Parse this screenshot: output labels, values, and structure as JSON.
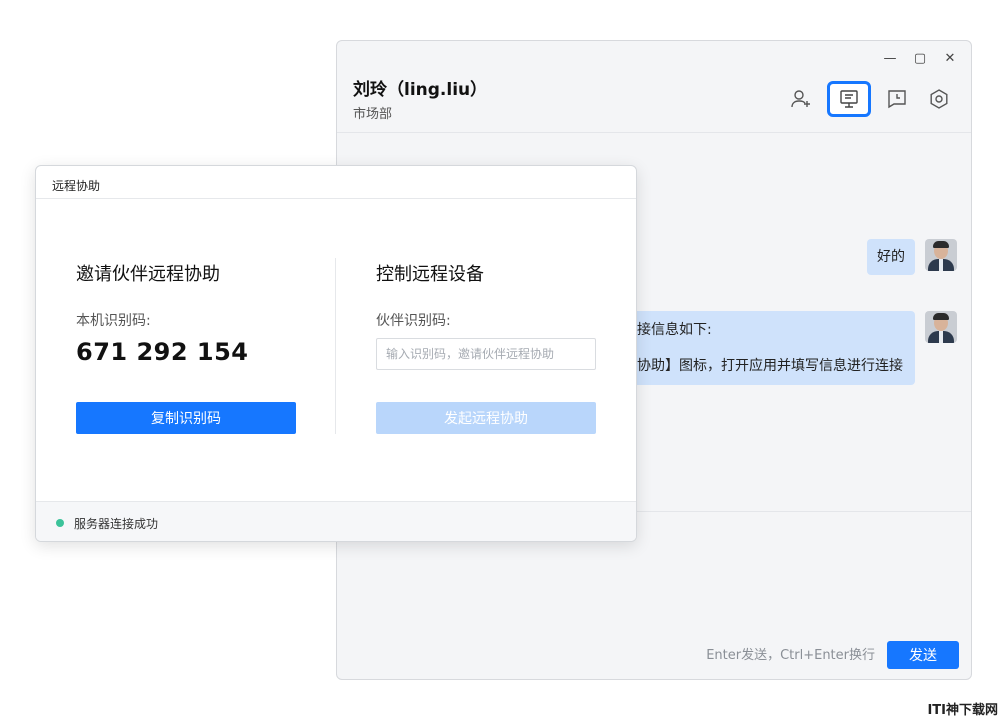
{
  "chat": {
    "contact_name": "刘玲（ling.liu）",
    "department": "市场部",
    "window_controls": {
      "minimize": "—",
      "maximize": "▢",
      "close": "✕"
    },
    "messages": [
      {
        "text": "好的"
      },
      {
        "line1": "接信息如下:",
        "line2": "协助】图标，打开应用并填写信息进行连接"
      }
    ],
    "send_hint": "Enter发送，Ctrl+Enter换行",
    "send_label": "发送"
  },
  "dialog": {
    "title": "远程协助",
    "invite": {
      "title": "邀请伙伴远程协助",
      "code_label": "本机识别码:",
      "code_value": "671 292 154",
      "copy_button": "复制识别码"
    },
    "control": {
      "title": "控制远程设备",
      "partner_label": "伙伴识别码:",
      "input_placeholder": "输入识别码，邀请伙伴远程协助",
      "input_value": "",
      "start_button": "发起远程协助"
    },
    "status": "服务器连接成功"
  },
  "colors": {
    "primary": "#1677ff",
    "primary_disabled": "#b9d6fb",
    "status_ok": "#3cc39a",
    "bubble": "#cfe2fb"
  },
  "watermark": "ITI神下载网"
}
